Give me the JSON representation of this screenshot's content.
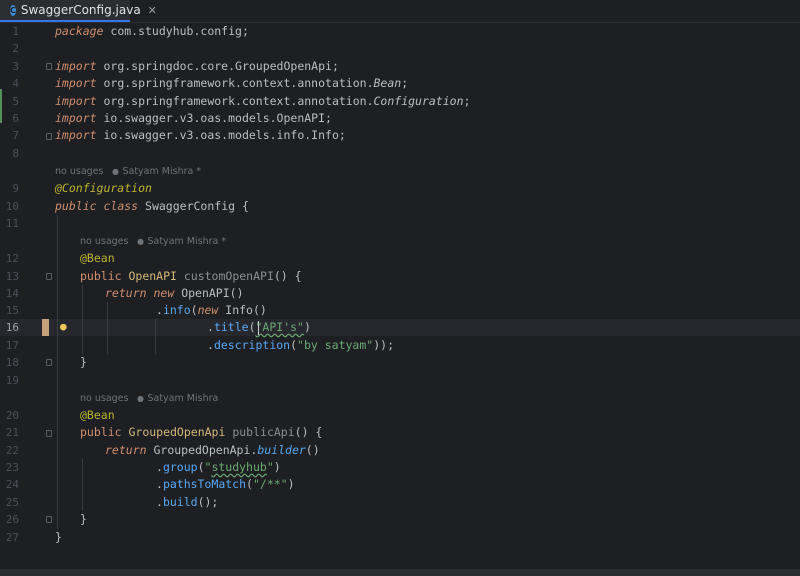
{
  "tab": {
    "title": "SwaggerConfig.java",
    "icon_letter": "C",
    "close_glyph": "✕"
  },
  "hints": {
    "class_hint": {
      "usages": "no usages",
      "author": "Satyam Mishra *"
    },
    "method1_hint": {
      "usages": "no usages",
      "author": "Satyam Mishra *"
    },
    "method2_hint": {
      "usages": "no usages",
      "author": "Satyam Mishra"
    }
  },
  "lines": [
    {
      "n": "1"
    },
    {
      "n": "2"
    },
    {
      "n": "3"
    },
    {
      "n": "4"
    },
    {
      "n": "5"
    },
    {
      "n": "6"
    },
    {
      "n": "7"
    },
    {
      "n": "8"
    },
    {
      "n": "9"
    },
    {
      "n": "10"
    },
    {
      "n": "11"
    },
    {
      "n": "12"
    },
    {
      "n": "13"
    },
    {
      "n": "14"
    },
    {
      "n": "15"
    },
    {
      "n": "16"
    },
    {
      "n": "17"
    },
    {
      "n": "18"
    },
    {
      "n": "19"
    },
    {
      "n": "20"
    },
    {
      "n": "21"
    },
    {
      "n": "22"
    },
    {
      "n": "23"
    },
    {
      "n": "24"
    },
    {
      "n": "25"
    },
    {
      "n": "26"
    },
    {
      "n": "27"
    }
  ],
  "code": {
    "l1": {
      "kw": "package",
      "rest": " com.studyhub.config;"
    },
    "l3": {
      "kw": "import",
      "rest": " org.springdoc.core.GroupedOpenApi;"
    },
    "l4": {
      "kw": "import",
      "rest": " org.springframework.context.annotation.",
      "cls": "Bean",
      "end": ";"
    },
    "l5": {
      "kw": "import",
      "rest": " org.springframework.context.annotation.",
      "cls": "Configuration",
      "end": ";"
    },
    "l6": {
      "kw": "import",
      "rest": " io.swagger.v3.oas.models.OpenAPI;"
    },
    "l7": {
      "kw": "import",
      "rest": " io.swagger.v3.oas.models.info.Info;"
    },
    "l9": {
      "ann": "@Configuration"
    },
    "l10": {
      "kw1": "public",
      "kw2": "class",
      "name": " SwaggerConfig",
      "end": " {"
    },
    "l12": {
      "ann": "@Bean"
    },
    "l13": {
      "kw1": "public",
      "type": " OpenAPI",
      "name": " customOpenAPI",
      "end": "() {"
    },
    "l14": {
      "kw1": "return",
      "kw2": "new",
      "rest": " OpenAPI()"
    },
    "l15": {
      "dot": ".",
      "fn": "info",
      "p1": "(",
      "kw": "new",
      "rest": " Info()"
    },
    "l16": {
      "dot": ".",
      "fn": "title",
      "p1": "(",
      "str": "\"API's\"",
      "p2": ")"
    },
    "l17": {
      "dot": ".",
      "fn": "description",
      "p1": "(",
      "str": "\"by satyam\"",
      "p2": "));"
    },
    "l18": {
      "text": "}"
    },
    "l20": {
      "ann": "@Bean"
    },
    "l21": {
      "kw1": "public",
      "type": " GroupedOpenApi",
      "name": " publicApi",
      "end": "() {"
    },
    "l22": {
      "kw1": "return",
      "rest": " GroupedOpenApi.",
      "fn": "builder",
      "end": "()"
    },
    "l23": {
      "dot": ".",
      "fn": "group",
      "p1": "(",
      "q1": "\"",
      "sq": "studyhub",
      "q2": "\"",
      "p2": ")"
    },
    "l24": {
      "dot": ".",
      "fn": "pathsToMatch",
      "p1": "(",
      "str": "\"/**\"",
      "p2": ")"
    },
    "l25": {
      "dot": ".",
      "fn": "build",
      "p2": "();"
    },
    "l26": {
      "text": "}"
    },
    "l27": {
      "text": "}"
    }
  },
  "colors": {
    "keyword": "#cf8e6d",
    "annotation": "#bbb529",
    "string": "#6aab73",
    "method": "#56a8f5",
    "accent": "#3574f0"
  },
  "icons": {
    "file": "java-class-icon",
    "bulb": "lightbulb-icon",
    "author": "person-icon"
  }
}
